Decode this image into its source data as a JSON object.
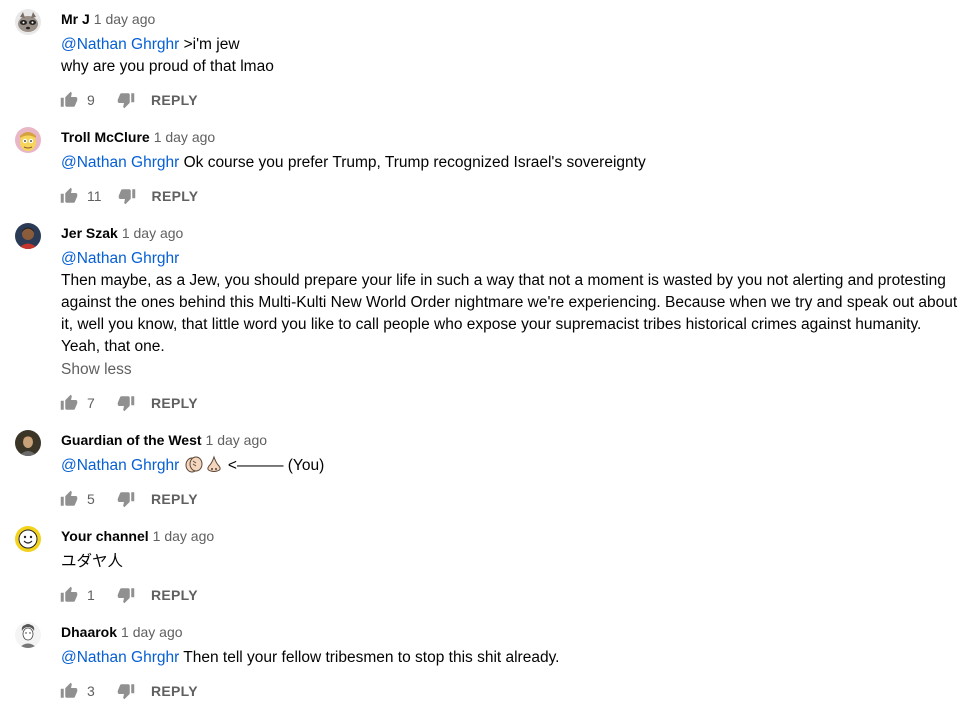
{
  "comments": [
    {
      "author": "Mr J",
      "time": "1 day ago",
      "mention": "@Nathan Ghrghr",
      "first_line": ">i'm jew",
      "body": "why are you proud of that lmao",
      "likes": "9",
      "reply": "REPLY",
      "avatar_icon": "raccoon-avatar"
    },
    {
      "author": "Troll McClure",
      "time": "1 day ago",
      "mention": "@Nathan Ghrghr",
      "first_line": "Ok course you prefer Trump, Trump recognized Israel's sovereignty",
      "likes": "11",
      "reply": "REPLY",
      "avatar_icon": "cartoon-avatar"
    },
    {
      "author": "Jer Szak",
      "time": "1 day ago",
      "mention": "@Nathan Ghrghr",
      "body": "Then maybe, as a Jew, you should prepare your life in such a way that not a moment is wasted by you not alerting and protesting against the ones behind this Multi-Kulti New World Order nightmare we're experiencing. Because when we try and speak out about it, well you know, that little word you like to call people who expose your supremacist tribes historical crimes against humanity. Yeah, that one.",
      "show_less": "Show less",
      "likes": "7",
      "reply": "REPLY",
      "avatar_icon": "photo-avatar"
    },
    {
      "author": "Guardian of the West",
      "time": "1 day ago",
      "mention": "@Nathan Ghrghr",
      "first_line": "<——— (You)",
      "likes": "5",
      "reply": "REPLY",
      "avatar_icon": "portrait-avatar"
    },
    {
      "author": "Your channel",
      "time": "1 day ago",
      "body": "ユダヤ人",
      "likes": "1",
      "reply": "REPLY",
      "avatar_icon": "smiley-avatar"
    },
    {
      "author": "Dhaarok",
      "time": "1 day ago",
      "mention": "@Nathan Ghrghr",
      "first_line": "Then tell your fellow tribesmen to stop this shit already.",
      "likes": "3",
      "reply": "REPLY",
      "avatar_icon": "sketch-avatar"
    }
  ],
  "colors": {
    "mention": "#065fd4",
    "meta": "#606060",
    "text": "#030303"
  }
}
